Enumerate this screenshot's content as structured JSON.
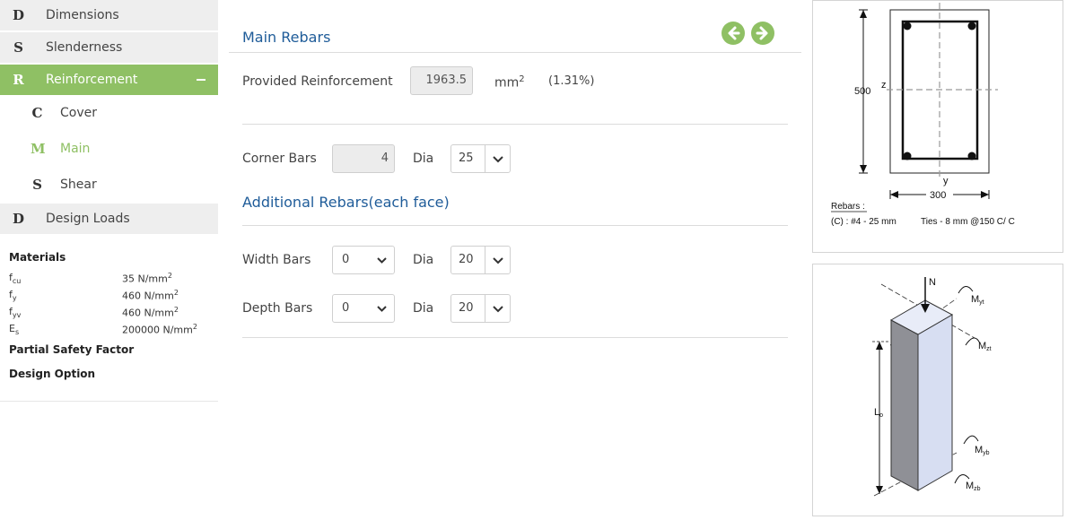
{
  "sidebar": {
    "items": [
      {
        "letter": "D",
        "label": "Dimensions"
      },
      {
        "letter": "S",
        "label": "Slenderness"
      },
      {
        "letter": "R",
        "label": "Reinforcement"
      },
      {
        "letter": "C",
        "label": "Cover"
      },
      {
        "letter": "M",
        "label": "Main"
      },
      {
        "letter": "S",
        "label": "Shear"
      },
      {
        "letter": "D",
        "label": "Design Loads"
      }
    ],
    "materials": {
      "title": "Materials",
      "rows": [
        {
          "sym": "f",
          "sub": "cu",
          "val": "35 N/mm",
          "sup": "2"
        },
        {
          "sym": "f",
          "sub": "y",
          "val": "460 N/mm",
          "sup": "2"
        },
        {
          "sym": "f",
          "sub": "yv",
          "val": "460 N/mm",
          "sup": "2"
        },
        {
          "sym": "E",
          "sub": "s",
          "val": "200000 N/mm",
          "sup": "2"
        }
      ],
      "partial_safety_factor": "Partial Safety Factor",
      "design_option": "Design Option"
    }
  },
  "main": {
    "title": "Main Rebars",
    "provided_label": "Provided Reinforcement",
    "provided_value": "1963.5",
    "provided_unit": "mm",
    "provided_unit_sup": "2",
    "provided_pct": "(1.31%)",
    "corner_label": "Corner Bars",
    "corner_value": "4",
    "dia_label": "Dia",
    "corner_dia": "25",
    "additional_title": "Additional Rebars(each face)",
    "width_label": "Width Bars",
    "width_value": "0",
    "width_dia": "20",
    "depth_label": "Depth Bars",
    "depth_value": "0",
    "depth_dia": "20"
  },
  "section_diagram": {
    "dim_height": "500",
    "dim_width": "300",
    "z_label": "z",
    "y_label": "y",
    "rebars_label": "Rebars :",
    "rebars_value": "(C) : #4 - 25 mm",
    "ties_value": "Ties - 8 mm @150 C/ C"
  },
  "column_diagram": {
    "n_label": "N",
    "myt": "M",
    "myt_sub": "yt",
    "mzt": "M",
    "mzt_sub": "zt",
    "lo": "L",
    "lo_sub": "o",
    "myb": "M",
    "myb_sub": "yb",
    "mzb": "M",
    "mzb_sub": "zb"
  },
  "colors": {
    "accent_green": "#8fc064",
    "title_blue": "#1f5c99",
    "nav_grey": "#eeeeee"
  }
}
